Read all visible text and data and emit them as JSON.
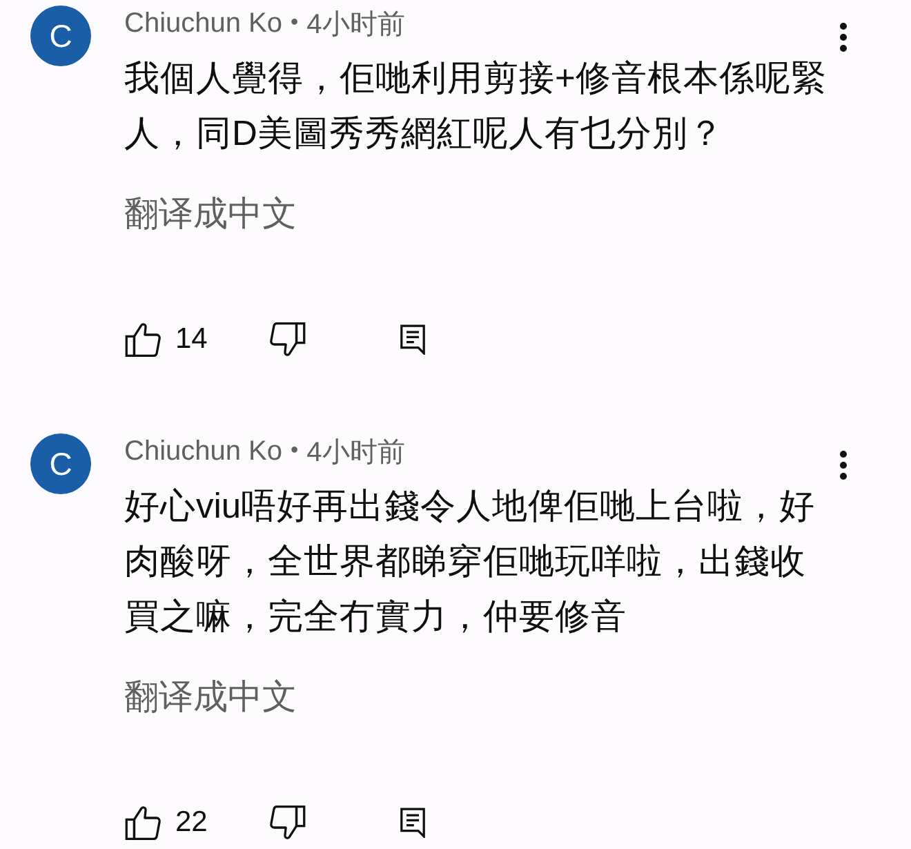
{
  "comments": [
    {
      "avatar_letter": "C",
      "author": "Chiuchun Ko",
      "separator": "•",
      "time": "4小时前",
      "text": "我個人覺得，佢哋利用剪接+修音根本係呢緊人，同D美圖秀秀網紅呢人有乜分別？",
      "translate_link": "翻译成中文",
      "likes": "14"
    },
    {
      "avatar_letter": "C",
      "author": "Chiuchun Ko",
      "separator": "•",
      "time": "4小时前",
      "text": "好心viu唔好再出錢令人地俾佢哋上台啦，好肉酸呀，全世界都睇穿佢哋玩咩啦，出錢收買之嘛，完全冇實力，仲要修音",
      "translate_link": "翻译成中文",
      "likes": "22"
    }
  ]
}
